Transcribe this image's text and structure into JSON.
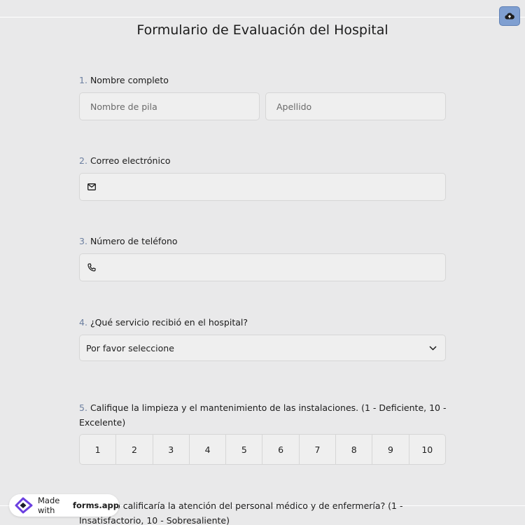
{
  "form": {
    "title": "Formulario de Evaluación del Hospital",
    "questions": [
      {
        "number": "1.",
        "label": "Nombre completo",
        "first_placeholder": "Nombre de pila",
        "last_placeholder": "Apellido"
      },
      {
        "number": "2.",
        "label": "Correo electrónico",
        "icon": "mail-icon"
      },
      {
        "number": "3.",
        "label": "Número de teléfono",
        "icon": "phone-icon"
      },
      {
        "number": "4.",
        "label": "¿Qué servicio recibió en el hospital?",
        "select_value": "Por favor seleccione"
      },
      {
        "number": "5.",
        "label": "Califique la limpieza y el mantenimiento de las instalaciones. (1 - Deficiente, 10 - Excelente)",
        "scale": [
          "1",
          "2",
          "3",
          "4",
          "5",
          "6",
          "7",
          "8",
          "9",
          "10"
        ]
      },
      {
        "number": "6.",
        "label": "¿Cómo calificaría la atención del personal médico y de enfermería? (1 - Insatisfactorio, 10 - Sobresaliente)"
      }
    ]
  },
  "toolbar": {
    "upload_icon": "cloud-upload-icon"
  },
  "badge": {
    "prefix": "Made with",
    "brand": "forms.app"
  },
  "colors": {
    "background": "#e9e9ea",
    "accent": "#7f9fd1",
    "number": "#6c7fa0"
  }
}
